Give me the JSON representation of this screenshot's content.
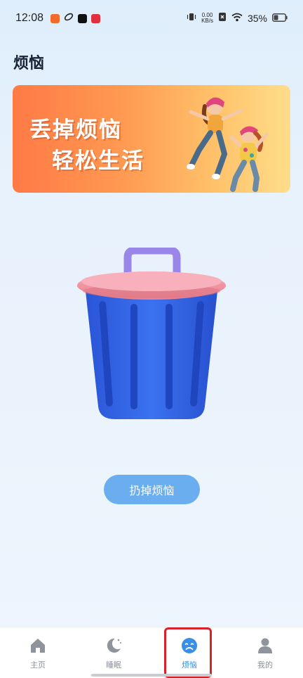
{
  "status_bar": {
    "time": "12:08",
    "net_speed_value": "0.00",
    "net_speed_unit": "KB/s",
    "battery": "35%"
  },
  "header": {
    "title": "烦恼"
  },
  "banner": {
    "line1": "丢掉烦恼",
    "line2": "轻松生活"
  },
  "main": {
    "action_button_label": "扔掉烦恼"
  },
  "tab_bar": {
    "active_tab": "烦恼",
    "tabs": [
      {
        "label": "主页",
        "icon": "home-icon"
      },
      {
        "label": "睡眠",
        "icon": "moon-icon"
      },
      {
        "label": "烦恼",
        "icon": "sad-face-icon"
      },
      {
        "label": "我的",
        "icon": "person-icon"
      }
    ]
  },
  "colors": {
    "accent": "#3b8ee8",
    "button": "#6aaef0",
    "banner_start": "#ff7a45",
    "banner_end": "#ffdd8a",
    "trash_body": "#2f64e6",
    "trash_lid": "#f291a2",
    "trash_handle": "#9b86e6",
    "highlight": "#d7212b"
  }
}
